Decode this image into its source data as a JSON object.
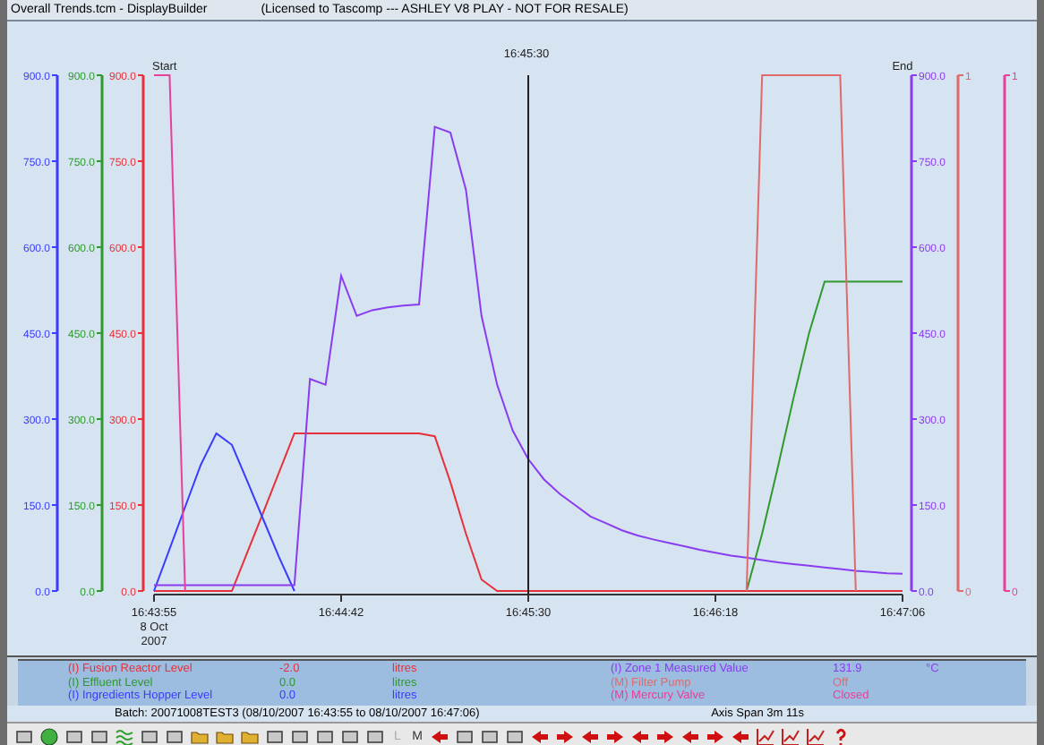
{
  "window": {
    "title": "Overall Trends.tcm - DisplayBuilder",
    "license": "(Licensed to Tascomp --- ASHLEY V8 PLAY - NOT FOR RESALE)"
  },
  "trend": {
    "cursor_time": "16:45:30",
    "start_label": "Start",
    "end_label": "End",
    "date_lines": [
      "8 Oct",
      "2007"
    ],
    "left_axes": [
      {
        "color": "#3b3bff",
        "labels": [
          "900.0",
          "750.0",
          "600.0",
          "450.0",
          "300.0",
          "150.0",
          "0.0"
        ]
      },
      {
        "color": "#2e9a2e",
        "labels": [
          "900.0",
          "750.0",
          "600.0",
          "450.0",
          "300.0",
          "150.0",
          "0.0"
        ]
      },
      {
        "color": "#e8303a"
      }
    ],
    "right_axes": [
      {
        "color": "#8a3cf0",
        "labels": [
          "900.0",
          "750.0",
          "600.0",
          "450.0",
          "300.0",
          "150.0",
          "0.0"
        ]
      },
      {
        "color": "#e06a6a",
        "labels": [
          "1",
          "0"
        ]
      },
      {
        "color": "#e8409a",
        "labels": [
          "1",
          "0"
        ]
      }
    ],
    "chart_data": {
      "type": "line",
      "categories": [
        "16:43:55",
        null,
        null,
        null,
        null,
        null,
        null,
        null,
        null,
        null,
        null,
        null,
        "16:44:42",
        null,
        null,
        null,
        null,
        null,
        null,
        null,
        null,
        null,
        null,
        null,
        "16:45:30",
        null,
        null,
        null,
        null,
        null,
        null,
        null,
        null,
        null,
        null,
        null,
        "16:46:18",
        null,
        null,
        null,
        null,
        null,
        null,
        null,
        null,
        null,
        null,
        null,
        "16:47:06"
      ],
      "ylim": [
        0,
        900
      ],
      "yticks": [
        {
          "value": 0,
          "label": "0.0"
        },
        {
          "value": 150,
          "label": "150.0"
        },
        {
          "value": 300,
          "label": "300.0"
        },
        {
          "value": 450,
          "label": "450.0"
        },
        {
          "value": 600,
          "label": "600.0"
        },
        {
          "value": 750,
          "label": "750.0"
        },
        {
          "value": 900,
          "label": "900.0"
        }
      ],
      "series": [
        {
          "color": "#e8303a",
          "values": [
            0,
            0,
            0,
            0,
            0,
            0,
            69,
            137,
            206,
            275,
            275,
            275,
            275,
            275,
            275,
            275,
            275,
            275,
            270,
            190,
            100,
            20,
            0,
            0,
            0,
            0,
            0,
            0,
            0,
            0,
            0,
            0,
            0,
            0,
            0,
            0,
            0,
            0,
            0,
            0,
            0,
            0,
            0,
            0,
            0,
            0,
            0,
            0,
            0
          ]
        },
        {
          "color": "#2e9a2e",
          "values": [
            null,
            null,
            null,
            null,
            null,
            null,
            null,
            null,
            null,
            null,
            null,
            null,
            null,
            null,
            null,
            null,
            null,
            null,
            null,
            null,
            null,
            null,
            null,
            null,
            null,
            null,
            null,
            null,
            null,
            null,
            null,
            null,
            null,
            null,
            null,
            null,
            null,
            null,
            0,
            100,
            215,
            335,
            450,
            540,
            540,
            540,
            540,
            540,
            540
          ]
        },
        {
          "color": "#3b3bff",
          "values": [
            0,
            73,
            147,
            220,
            275,
            255,
            190,
            125,
            60,
            0,
            null,
            null,
            null,
            null,
            null,
            null,
            null,
            null,
            null,
            null,
            null,
            null,
            null,
            null,
            null,
            null,
            null,
            null,
            null,
            null,
            null,
            null,
            null,
            null,
            null,
            null,
            null,
            null,
            null,
            null,
            null,
            null,
            null,
            null,
            null,
            null,
            null,
            null,
            null
          ]
        },
        {
          "color": "#8a3cf0",
          "values": [
            10,
            10,
            10,
            10,
            10,
            10,
            10,
            10,
            10,
            10,
            370,
            360,
            550,
            480,
            490,
            495,
            498,
            500,
            810,
            800,
            700,
            480,
            360,
            280,
            230,
            195,
            170,
            150,
            130,
            118,
            106,
            97,
            90,
            84,
            78,
            72,
            67,
            62,
            58,
            54,
            50,
            47,
            44,
            41,
            38,
            35,
            33,
            31,
            30
          ]
        },
        {
          "color": "#e06a6a",
          "values": [
            null,
            null,
            null,
            null,
            null,
            null,
            null,
            null,
            null,
            null,
            null,
            null,
            null,
            null,
            null,
            null,
            null,
            null,
            null,
            null,
            null,
            null,
            null,
            null,
            null,
            null,
            null,
            null,
            null,
            null,
            null,
            null,
            null,
            null,
            null,
            null,
            null,
            null,
            0,
            900,
            900,
            900,
            900,
            900,
            900,
            0,
            null,
            null,
            null
          ]
        },
        {
          "color": "#e8409a",
          "values": [
            900,
            900,
            0,
            null,
            null,
            null,
            null,
            null,
            null,
            null,
            null,
            null,
            null,
            null,
            null,
            null,
            null,
            null,
            null,
            null,
            null,
            null,
            null,
            null,
            null,
            null,
            null,
            null,
            null,
            null,
            null,
            null,
            null,
            null,
            null,
            null,
            null,
            null,
            null,
            null,
            null,
            null,
            null,
            null,
            null,
            null,
            null,
            null,
            null
          ]
        }
      ]
    }
  },
  "legend": [
    {
      "name": "(I) Fusion Reactor Level",
      "value": "-2.0",
      "unit": "litres",
      "color": "#e8303a"
    },
    {
      "name": "(I) Zone 1 Measured Value",
      "value": "131.9",
      "unit": "°C",
      "color": "#8a3cf0"
    },
    {
      "name": "(I) Effluent Level",
      "value": "0.0",
      "unit": "litres",
      "color": "#2e9a2e"
    },
    {
      "name": "(M) Filter Pump",
      "value": "Off",
      "color": "#e06a6a"
    },
    {
      "name": "(I) Ingredients Hopper Level",
      "value": "0.0",
      "unit": "litres",
      "color": "#3b3bff"
    },
    {
      "name": "(M) Mercury Valve",
      "value": "Closed",
      "color": "#e8409a"
    }
  ],
  "status_bar": {
    "batch": "Batch: 20071008TEST3 (08/10/2007 16:43:55 to 08/10/2007 16:47:06)",
    "span": "Axis Span 3m 11s"
  },
  "toolbar": [
    {
      "label": "L",
      "disabled": true
    },
    {
      "label": "M",
      "disabled": false
    }
  ]
}
